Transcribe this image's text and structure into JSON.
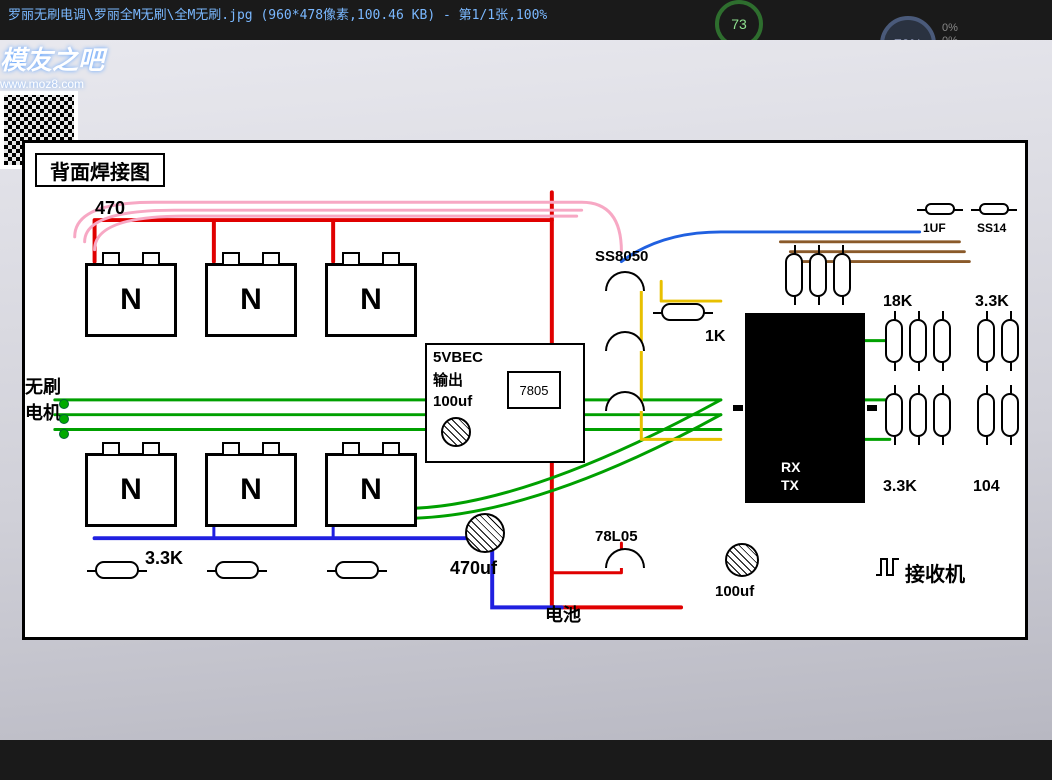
{
  "titlebar": "罗丽无刷电调\\罗丽全M无刷\\全M无刷.jpg (960*478像素,100.46 KB) - 第1/1张,100%",
  "hud": {
    "green": "73",
    "blue": "73%",
    "side_top": "0%",
    "side_bot": "0%"
  },
  "diagram": {
    "title": "背面焊接图",
    "mosfet_label": "N",
    "labels": {
      "r470": "470",
      "motor": "无刷\n电机",
      "r3_3k_L": "3.3K",
      "vbec_title": "5VBEC",
      "vbec_out": "输出",
      "reg_7805": "7805",
      "c100uf": "100uf",
      "c470uf": "470uf",
      "battery": "电池",
      "ss8050": "SS8050",
      "r1k": "1K",
      "r18k": "18K",
      "r3_3k_R": "3.3K",
      "c1uf": "1UF",
      "ss14": "SS14",
      "c104": "104",
      "reg_78l05": "78L05",
      "c100uf_2": "100uf",
      "rx": "RX",
      "tx": "TX",
      "receiver": "接收机"
    }
  },
  "watermark": {
    "main": "模友之吧",
    "sub": "www.moz8.com"
  }
}
